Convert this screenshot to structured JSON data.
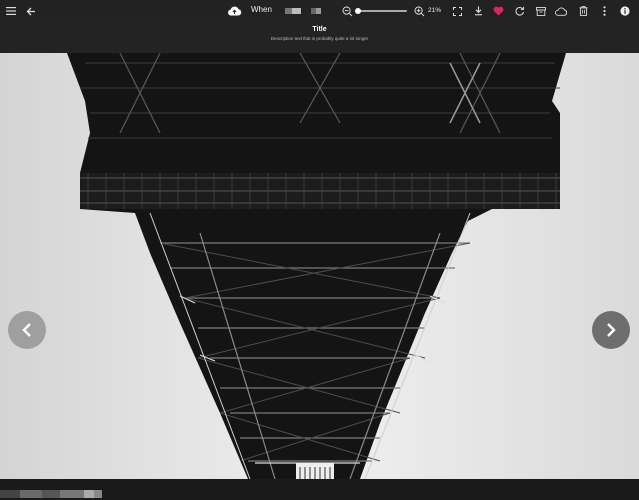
{
  "toolbar": {
    "menu_icon": "hamburger-menu-icon",
    "back_icon": "arrow-left-icon",
    "cloud_icon": "cloud-upload-icon",
    "when_label": "When",
    "zoom_out_icon": "zoom-out-icon",
    "zoom_in_icon": "zoom-in-icon",
    "zoom_value": "21%",
    "zoom_fraction": 0.21,
    "fullscreen_icon": "fullscreen-icon",
    "download_icon": "download-icon",
    "favorite_icon": "heart-icon",
    "rotate_icon": "rotate-icon",
    "archive_icon": "archive-icon",
    "cloud_off_icon": "cloud-off-icon",
    "delete_icon": "trash-icon",
    "more_icon": "more-vertical-icon",
    "info_icon": "info-icon",
    "favorite_color": "#e0245e"
  },
  "header": {
    "title": "Title",
    "description": "Description text that is probably quite a lot longer"
  },
  "viewer": {
    "prev_icon": "chevron-left-icon",
    "next_icon": "chevron-right-icon"
  }
}
